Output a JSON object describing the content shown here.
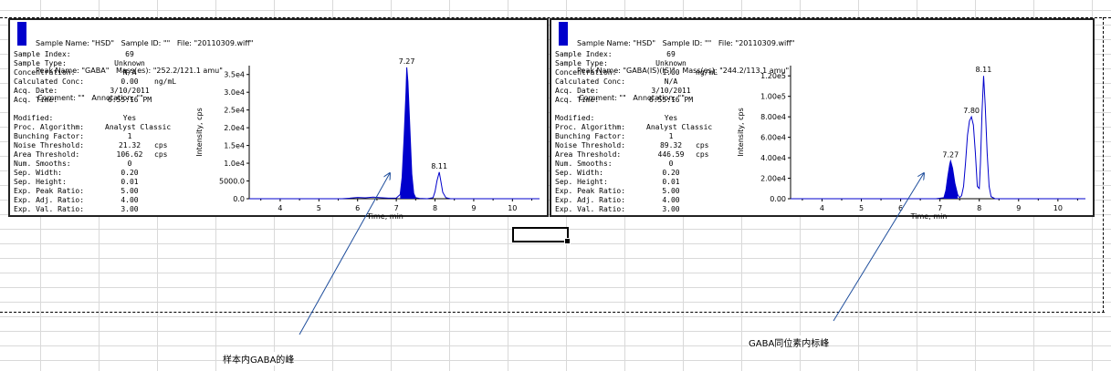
{
  "left_panel": {
    "header_lines": [
      "Sample Name: \"HSD\"   Sample ID: \"\"   File: \"20110309.wiff\"",
      "Peak Name: \"GABA\"   Mass(es): \"252.2/121.1 amu\"",
      "Comment: \"\"   Annotation: \"\""
    ],
    "params_a": [
      {
        "label": "Sample Index:",
        "value": "69",
        "unit": ""
      },
      {
        "label": "Sample Type:",
        "value": "Unknown",
        "unit": ""
      },
      {
        "label": "Concentration:",
        "value": "N/A",
        "unit": ""
      },
      {
        "label": "Calculated Conc:",
        "value": "0.00",
        "unit": "ng/mL"
      },
      {
        "label": "Acq. Date:",
        "value": "3/10/2011",
        "unit": ""
      },
      {
        "label": "Acq. Time:",
        "value": "6:55:16 PM",
        "unit": ""
      }
    ],
    "params_b": [
      {
        "label": "Modified:",
        "value": "Yes",
        "unit": ""
      },
      {
        "label": "Proc. Algorithm:",
        "value": "Analyst Classic",
        "unit": ""
      },
      {
        "label": "Bunching Factor:",
        "value": "1",
        "unit": ""
      },
      {
        "label": "Noise Threshold:",
        "value": "21.32",
        "unit": "cps"
      },
      {
        "label": "Area Threshold:",
        "value": "106.62",
        "unit": "cps"
      },
      {
        "label": "Num. Smooths:",
        "value": "0",
        "unit": ""
      },
      {
        "label": "Sep. Width:",
        "value": "0.20",
        "unit": ""
      },
      {
        "label": "Sep. Height:",
        "value": "0.01",
        "unit": ""
      },
      {
        "label": "Exp. Peak Ratio:",
        "value": "5.00",
        "unit": ""
      },
      {
        "label": "Exp. Adj. Ratio:",
        "value": "4.00",
        "unit": ""
      },
      {
        "label": "Exp. Val. Ratio:",
        "value": "3.00",
        "unit": ""
      }
    ]
  },
  "right_panel": {
    "header_lines": [
      "Sample Name: \"HSD\"   Sample ID: \"\"   File: \"20110309.wiff\"",
      "Peak Name: \"GABA(IS)(IS)\"   Mass(es): \"244.2/113.1 amu\"",
      "Comment: \"\"   Annotation: \"\""
    ],
    "params_a": [
      {
        "label": "Sample Index:",
        "value": "69",
        "unit": ""
      },
      {
        "label": "Sample Type:",
        "value": "Unknown",
        "unit": ""
      },
      {
        "label": "Concentration:",
        "value": "1.00",
        "unit": "ng/mL"
      },
      {
        "label": "Calculated Conc:",
        "value": "N/A",
        "unit": ""
      },
      {
        "label": "Acq. Date:",
        "value": "3/10/2011",
        "unit": ""
      },
      {
        "label": "Acq. Time:",
        "value": "6:55:16 PM",
        "unit": ""
      }
    ],
    "params_b": [
      {
        "label": "Modified:",
        "value": "Yes",
        "unit": ""
      },
      {
        "label": "Proc. Algorithm:",
        "value": "Analyst Classic",
        "unit": ""
      },
      {
        "label": "Bunching Factor:",
        "value": "1",
        "unit": ""
      },
      {
        "label": "Noise Threshold:",
        "value": "89.32",
        "unit": "cps"
      },
      {
        "label": "Area Threshold:",
        "value": "446.59",
        "unit": "cps"
      },
      {
        "label": "Num. Smooths:",
        "value": "0",
        "unit": ""
      },
      {
        "label": "Sep. Width:",
        "value": "0.20",
        "unit": ""
      },
      {
        "label": "Sep. Height:",
        "value": "0.01",
        "unit": ""
      },
      {
        "label": "Exp. Peak Ratio:",
        "value": "5.00",
        "unit": ""
      },
      {
        "label": "Exp. Adj. Ratio:",
        "value": "4.00",
        "unit": ""
      },
      {
        "label": "Exp. Val. Ratio:",
        "value": "3.00",
        "unit": ""
      }
    ]
  },
  "chart_data": [
    {
      "type": "line",
      "title": "",
      "xlabel": "Time, min",
      "ylabel": "Intensity, cps",
      "xlim": [
        3.2,
        10.7
      ],
      "ylim": [
        0,
        37500
      ],
      "x_ticks": [
        4,
        5,
        6,
        7,
        8,
        9,
        10
      ],
      "y_ticks": [
        0,
        5000,
        10000,
        15000,
        20000,
        25000,
        30000,
        35000
      ],
      "y_tick_labels": [
        "0.0",
        "5000.0",
        "1.0e4",
        "1.5e4",
        "2.0e4",
        "2.5e4",
        "3.0e4",
        "3.5e4"
      ],
      "grid": false,
      "peak_labels": [
        {
          "x": 7.27,
          "y": 37000,
          "label": "7.27"
        },
        {
          "x": 8.11,
          "y": 7500,
          "label": "8.11"
        }
      ],
      "series": [
        {
          "points": [
            [
              3.2,
              0
            ],
            [
              5.6,
              0
            ],
            [
              5.8,
              150
            ],
            [
              6.0,
              350
            ],
            [
              6.2,
              250
            ],
            [
              6.4,
              450
            ],
            [
              6.6,
              300
            ],
            [
              6.8,
              150
            ],
            [
              7.0,
              200
            ],
            [
              7.1,
              1200
            ],
            [
              7.15,
              6000
            ],
            [
              7.2,
              17000
            ],
            [
              7.25,
              30000
            ],
            [
              7.27,
              37000
            ],
            [
              7.3,
              33000
            ],
            [
              7.35,
              20000
            ],
            [
              7.4,
              7000
            ],
            [
              7.45,
              1500
            ],
            [
              7.5,
              300
            ],
            [
              7.6,
              100
            ],
            [
              7.8,
              0
            ],
            [
              7.95,
              300
            ],
            [
              8.0,
              2000
            ],
            [
              8.05,
              5000
            ],
            [
              8.11,
              7500
            ],
            [
              8.15,
              5000
            ],
            [
              8.2,
              1800
            ],
            [
              8.28,
              300
            ],
            [
              8.4,
              0
            ],
            [
              10.7,
              0
            ]
          ],
          "filled_range": [
            7.05,
            7.5
          ]
        }
      ],
      "color": "#0000cc"
    },
    {
      "type": "line",
      "title": "",
      "xlabel": "Time, min",
      "ylabel": "Intensity, cps",
      "xlim": [
        3.2,
        10.7
      ],
      "ylim": [
        0,
        130000
      ],
      "x_ticks": [
        4,
        5,
        6,
        7,
        8,
        9,
        10
      ],
      "y_ticks": [
        0,
        20000,
        40000,
        60000,
        80000,
        100000,
        120000
      ],
      "y_tick_labels": [
        "0.00",
        "2.00e4",
        "4.00e4",
        "6.00e4",
        "8.00e4",
        "1.00e5",
        "1.20e5"
      ],
      "grid": false,
      "peak_labels": [
        {
          "x": 7.27,
          "y": 37000,
          "label": "7.27"
        },
        {
          "x": 7.8,
          "y": 80000,
          "label": "7.80"
        },
        {
          "x": 8.11,
          "y": 120000,
          "label": "8.11"
        }
      ],
      "series": [
        {
          "points": [
            [
              3.2,
              0
            ],
            [
              6.9,
              0
            ],
            [
              7.1,
              1000
            ],
            [
              7.15,
              8000
            ],
            [
              7.2,
              22000
            ],
            [
              7.25,
              34000
            ],
            [
              7.27,
              37000
            ],
            [
              7.32,
              30000
            ],
            [
              7.38,
              15000
            ],
            [
              7.45,
              4000
            ],
            [
              7.5,
              1000
            ],
            [
              7.55,
              3000
            ],
            [
              7.6,
              12000
            ],
            [
              7.65,
              35000
            ],
            [
              7.7,
              62000
            ],
            [
              7.75,
              76000
            ],
            [
              7.8,
              80000
            ],
            [
              7.85,
              72000
            ],
            [
              7.9,
              45000
            ],
            [
              7.95,
              12000
            ],
            [
              8.0,
              10000
            ],
            [
              8.03,
              35000
            ],
            [
              8.07,
              85000
            ],
            [
              8.11,
              120000
            ],
            [
              8.15,
              92000
            ],
            [
              8.2,
              45000
            ],
            [
              8.25,
              12000
            ],
            [
              8.3,
              2000
            ],
            [
              8.4,
              0
            ],
            [
              10.7,
              0
            ]
          ],
          "filled_range": [
            7.05,
            7.48
          ]
        }
      ],
      "color": "#0000cc"
    }
  ],
  "selected_cell": "",
  "annotations": {
    "left": "样本内GABA的峰",
    "right": "GABA同位素内标峰"
  }
}
